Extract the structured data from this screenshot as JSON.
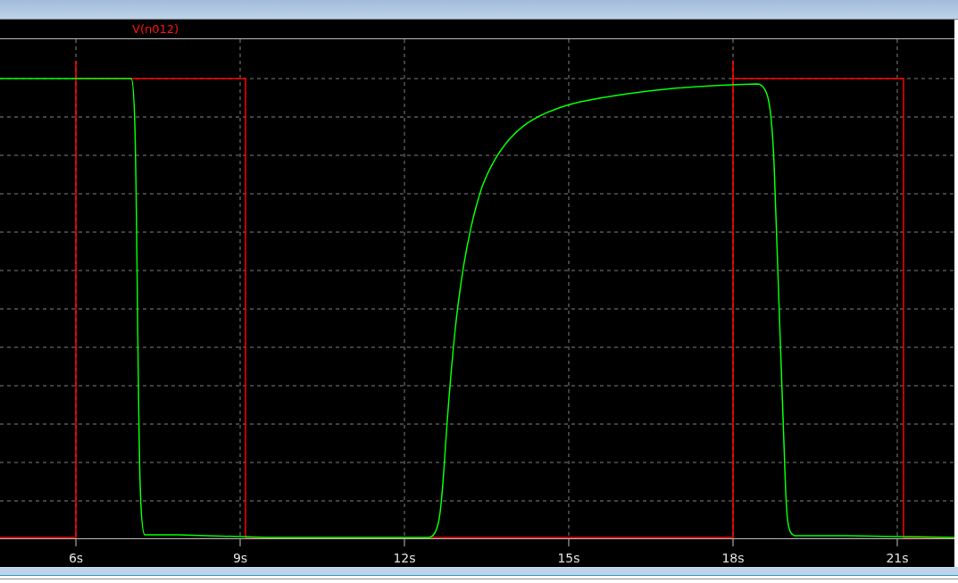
{
  "plot": {
    "trace_label": "V(n012)",
    "x_tick_labels": [
      "6s",
      "9s",
      "12s",
      "15s",
      "18s",
      "21s"
    ]
  }
}
